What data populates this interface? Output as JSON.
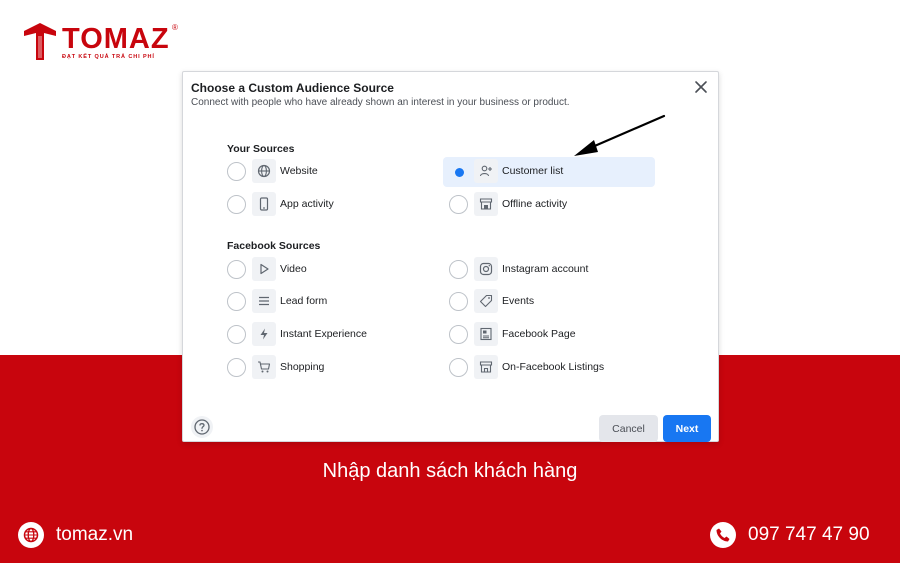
{
  "brand": {
    "name": "TOMAZ",
    "registered": "®",
    "tagline": "ĐẠT KẾT QUẢ TRẢ CHI PHÍ",
    "color": "#c8050d"
  },
  "dialog": {
    "title": "Choose a Custom Audience Source",
    "subtitle": "Connect with people who have already shown an interest in your business or product.",
    "close_icon": "close-icon",
    "your_sources": {
      "title": "Your Sources",
      "items": [
        {
          "label": "Website",
          "icon": "globe-icon",
          "selected": false
        },
        {
          "label": "App activity",
          "icon": "mobile-icon",
          "selected": false
        },
        {
          "label": "Customer list",
          "icon": "customer-list-icon",
          "selected": true
        },
        {
          "label": "Offline activity",
          "icon": "store-icon",
          "selected": false
        }
      ]
    },
    "facebook_sources": {
      "title": "Facebook Sources",
      "items": [
        {
          "label": "Video",
          "icon": "play-icon"
        },
        {
          "label": "Lead form",
          "icon": "lines-icon"
        },
        {
          "label": "Instant Experience",
          "icon": "bolt-icon"
        },
        {
          "label": "Shopping",
          "icon": "cart-icon"
        },
        {
          "label": "Instagram account",
          "icon": "instagram-icon"
        },
        {
          "label": "Events",
          "icon": "tag-icon"
        },
        {
          "label": "Facebook Page",
          "icon": "page-icon"
        },
        {
          "label": "On-Facebook Listings",
          "icon": "storefront-icon"
        }
      ]
    },
    "buttons": {
      "cancel": "Cancel",
      "next": "Next"
    },
    "accent_color": "#1877f2"
  },
  "caption": "Nhập danh sách khách hàng",
  "footer": {
    "website": "tomaz.vn",
    "phone": "097 747 47 90"
  }
}
